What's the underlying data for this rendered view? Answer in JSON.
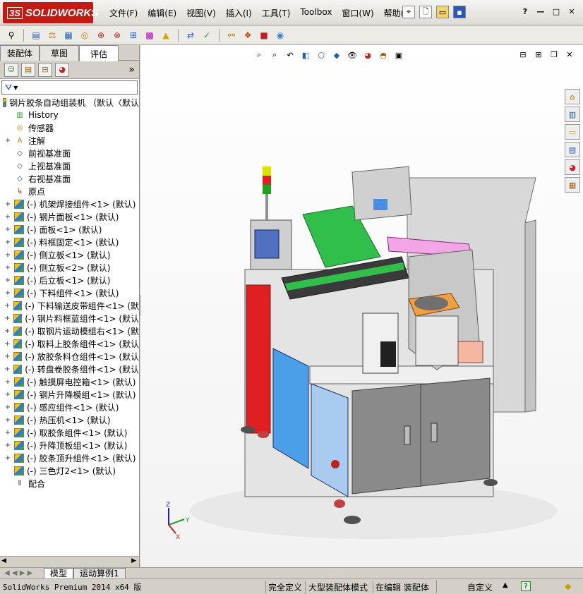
{
  "app": {
    "logo_text": "SOLIDWORKS",
    "logo_prefix": "3S"
  },
  "menu": [
    "文件(F)",
    "编辑(E)",
    "视图(V)",
    "插入(I)",
    "工具(T)",
    "Toolbox",
    "窗口(W)",
    "帮助(H)"
  ],
  "window_controls": {
    "help": "?",
    "minimize": "—",
    "restore": "□",
    "close": "✕"
  },
  "tabs": [
    "装配体",
    "草图",
    "评估"
  ],
  "active_tab": "评估",
  "panel_expand": "»",
  "filter_icon": "▼",
  "tree": {
    "root": "钢片胶条自动组装机 （默认〈默认",
    "items": [
      {
        "label": "History",
        "icon": "history",
        "exp": ""
      },
      {
        "label": "传感器",
        "icon": "sensor",
        "exp": ""
      },
      {
        "label": "注解",
        "icon": "annotation",
        "exp": "+"
      },
      {
        "label": "前视基准面",
        "icon": "plane",
        "exp": ""
      },
      {
        "label": "上视基准面",
        "icon": "plane",
        "exp": ""
      },
      {
        "label": "右视基准面",
        "icon": "plane",
        "exp": ""
      },
      {
        "label": "原点",
        "icon": "origin",
        "exp": ""
      },
      {
        "label": "(-) 机架焊接组件<1> (默认)",
        "icon": "part",
        "exp": "+"
      },
      {
        "label": "(-) 钢片面板<1> (默认)",
        "icon": "part",
        "exp": "+"
      },
      {
        "label": "(-) 面板<1> (默认)",
        "icon": "part",
        "exp": "+"
      },
      {
        "label": "(-) 料框固定<1> (默认)",
        "icon": "part",
        "exp": "+"
      },
      {
        "label": "(-) 侧立板<1> (默认)",
        "icon": "part",
        "exp": "+"
      },
      {
        "label": "(-) 侧立板<2> (默认)",
        "icon": "part",
        "exp": "+"
      },
      {
        "label": "(-) 后立板<1> (默认)",
        "icon": "part",
        "exp": "+"
      },
      {
        "label": "(-) 下料组件<1> (默认)",
        "icon": "part",
        "exp": "+"
      },
      {
        "label": "(-) 下料输送皮带组件<1> (默",
        "icon": "part",
        "exp": "+"
      },
      {
        "label": "(-) 钢片料框蓝组件<1> (默认",
        "icon": "part",
        "exp": "+"
      },
      {
        "label": "(-) 取钢片运动模组右<1> (默",
        "icon": "part",
        "exp": "+"
      },
      {
        "label": "(-) 取料上胶条组件<1> (默认",
        "icon": "part",
        "exp": "+"
      },
      {
        "label": "(-) 放胶条料仓组件<1> (默认",
        "icon": "part",
        "exp": "+"
      },
      {
        "label": "(-) 转盘卷胶条组件<1> (默认",
        "icon": "part",
        "exp": "+"
      },
      {
        "label": "(-) 触摸屏电控箱<1> (默认)",
        "icon": "part",
        "exp": "+"
      },
      {
        "label": "(-) 钢片升降模组<1> (默认)",
        "icon": "part",
        "exp": "+"
      },
      {
        "label": "(-) 感应组件<1> (默认)",
        "icon": "part",
        "exp": "+"
      },
      {
        "label": "(-) 热压机<1> (默认)",
        "icon": "part",
        "exp": "+"
      },
      {
        "label": "(-) 取胶条组件<1> (默认)",
        "icon": "part",
        "exp": "+"
      },
      {
        "label": "(-) 升降顶板组<1> (默认)",
        "icon": "part",
        "exp": "+"
      },
      {
        "label": "(-) 胶条顶升组件<1> (默认)",
        "icon": "part",
        "exp": "+"
      },
      {
        "label": "(-) 三色灯2<1> (默认)",
        "icon": "part",
        "exp": ""
      },
      {
        "label": "配合",
        "icon": "mate",
        "exp": ""
      }
    ]
  },
  "bottom_tabs": [
    "模型",
    "运动算例1"
  ],
  "status": {
    "version": "SolidWorks Premium 2014 x64 版",
    "defined": "完全定义",
    "mode": "大型装配体模式",
    "editing": "在编辑 装配体",
    "custom": "自定义"
  },
  "triad": {
    "x": "X",
    "y": "Y",
    "z": "Z"
  },
  "colors": {
    "logo_red": "#c41a12",
    "cabinet_red": "#e02020",
    "cabinet_blue": "#4a9fe8",
    "conveyor_green": "#2fbf4a",
    "panel_gray": "#8a8a8a"
  }
}
